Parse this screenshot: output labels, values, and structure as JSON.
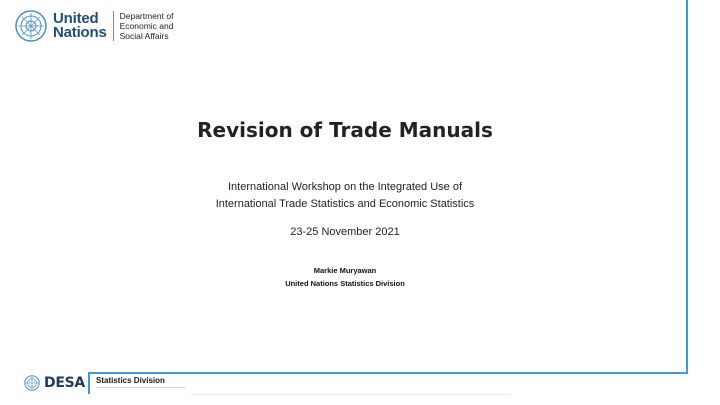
{
  "header": {
    "org_line1": "United",
    "org_line2": "Nations",
    "dept_line1": "Department of",
    "dept_line2": "Economic and",
    "dept_line3": "Social Affairs"
  },
  "slide": {
    "title": "Revision of Trade Manuals",
    "subtitle_line1": "International Workshop on the Integrated Use of",
    "subtitle_line2": "International Trade Statistics and Economic Statistics",
    "date": "23-25 November 2021",
    "presenter_name": "Markie Muryawan",
    "presenter_affiliation": "United Nations Statistics Division"
  },
  "footer": {
    "logo_text": "DESA",
    "division": "Statistics Division"
  },
  "colors": {
    "accent": "#3d9bd6",
    "un_blue": "#1f4e79"
  }
}
